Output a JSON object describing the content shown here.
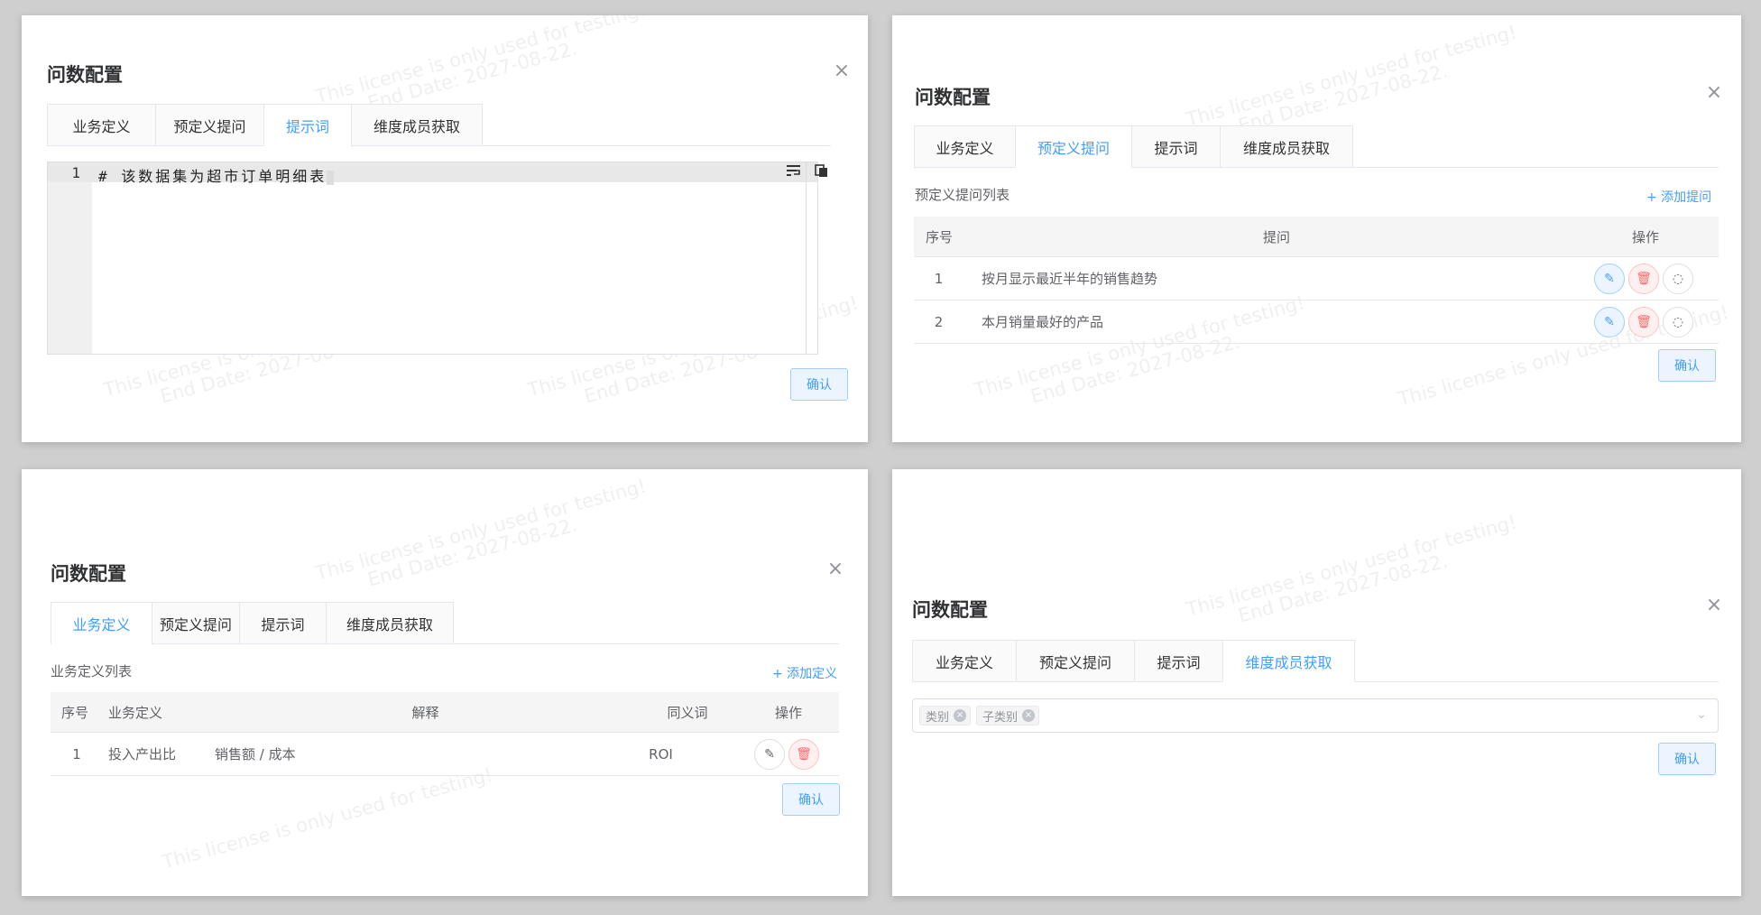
{
  "dialog_title": "问数配置",
  "close_glyph": "×",
  "confirm_label": "确认",
  "tabs": [
    "业务定义",
    "预定义提问",
    "提示词",
    "维度成员获取"
  ],
  "watermark": {
    "line1": "This license is only used for testing!",
    "line2": "End Date: 2027-08-22."
  },
  "prompt_panel": {
    "line_number": "1",
    "code_text": "# 该数据集为超市订单明细表"
  },
  "predefined_panel": {
    "list_label": "预定义提问列表",
    "add_label": "+ 添加提问",
    "columns": [
      "序号",
      "提问",
      "操作"
    ],
    "rows": [
      {
        "index": "1",
        "question": "按月显示最近半年的销售趋势"
      },
      {
        "index": "2",
        "question": "本月销量最好的产品"
      }
    ]
  },
  "definition_panel": {
    "list_label": "业务定义列表",
    "add_label": "+ 添加定义",
    "columns": [
      "序号",
      "业务定义",
      "解释",
      "同义词",
      "操作"
    ],
    "rows": [
      {
        "index": "1",
        "term": "投入产出比",
        "explanation": "销售额 / 成本",
        "synonym": "ROI"
      }
    ]
  },
  "dimension_panel": {
    "tags": [
      "类别",
      "子类别"
    ]
  },
  "colors": {
    "accent": "#409eff",
    "danger": "#f56c6c",
    "background": "#cfcfcf"
  }
}
